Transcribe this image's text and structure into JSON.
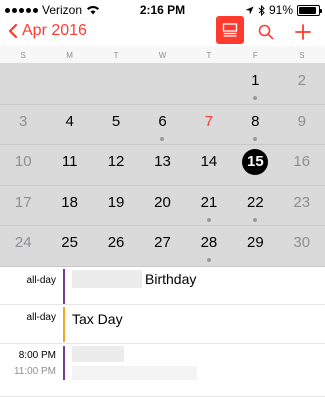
{
  "status": {
    "carrier": "Verizon",
    "time": "2:16 PM",
    "battery": "91%",
    "battery_level": 0.91
  },
  "nav": {
    "back_label": "Apr 2016",
    "accent": "#ff3b30"
  },
  "weekdays": [
    "S",
    "M",
    "T",
    "W",
    "T",
    "F",
    "S"
  ],
  "calendar": {
    "today": "7",
    "selected": "15",
    "weeks": [
      [
        {
          "label": "",
          "muted": false,
          "dot": false
        },
        {
          "label": "",
          "muted": false,
          "dot": false
        },
        {
          "label": "",
          "muted": false,
          "dot": false
        },
        {
          "label": "",
          "muted": false,
          "dot": false
        },
        {
          "label": "",
          "muted": false,
          "dot": false
        },
        {
          "label": "1",
          "muted": false,
          "dot": true
        },
        {
          "label": "2",
          "muted": true,
          "dot": false
        }
      ],
      [
        {
          "label": "3",
          "muted": true,
          "dot": false
        },
        {
          "label": "4",
          "muted": false,
          "dot": false
        },
        {
          "label": "5",
          "muted": false,
          "dot": false
        },
        {
          "label": "6",
          "muted": false,
          "dot": true
        },
        {
          "label": "7",
          "muted": false,
          "dot": false
        },
        {
          "label": "8",
          "muted": false,
          "dot": true
        },
        {
          "label": "9",
          "muted": true,
          "dot": false
        }
      ],
      [
        {
          "label": "10",
          "muted": true,
          "dot": false
        },
        {
          "label": "11",
          "muted": false,
          "dot": false
        },
        {
          "label": "12",
          "muted": false,
          "dot": false
        },
        {
          "label": "13",
          "muted": false,
          "dot": false
        },
        {
          "label": "14",
          "muted": false,
          "dot": false
        },
        {
          "label": "15",
          "muted": false,
          "dot": false
        },
        {
          "label": "16",
          "muted": true,
          "dot": false
        }
      ],
      [
        {
          "label": "17",
          "muted": true,
          "dot": false
        },
        {
          "label": "18",
          "muted": false,
          "dot": false
        },
        {
          "label": "19",
          "muted": false,
          "dot": false
        },
        {
          "label": "20",
          "muted": false,
          "dot": false
        },
        {
          "label": "21",
          "muted": false,
          "dot": true
        },
        {
          "label": "22",
          "muted": false,
          "dot": true
        },
        {
          "label": "23",
          "muted": true,
          "dot": false
        }
      ],
      [
        {
          "label": "24",
          "muted": true,
          "dot": false
        },
        {
          "label": "25",
          "muted": false,
          "dot": false
        },
        {
          "label": "26",
          "muted": false,
          "dot": false
        },
        {
          "label": "27",
          "muted": false,
          "dot": false
        },
        {
          "label": "28",
          "muted": false,
          "dot": true
        },
        {
          "label": "29",
          "muted": false,
          "dot": false
        },
        {
          "label": "30",
          "muted": true,
          "dot": false
        }
      ]
    ]
  },
  "events": [
    {
      "time": "all-day",
      "end": "",
      "title": "Birthday",
      "color": "#7a3d8c",
      "blurred_prefix": true
    },
    {
      "time": "all-day",
      "end": "",
      "title": "Tax Day",
      "color": "#f5a623",
      "blurred_prefix": false
    },
    {
      "time": "8:00 PM",
      "end": "11:00 PM",
      "title": "",
      "color": "#7a3d8c",
      "blurred_prefix": true
    }
  ]
}
